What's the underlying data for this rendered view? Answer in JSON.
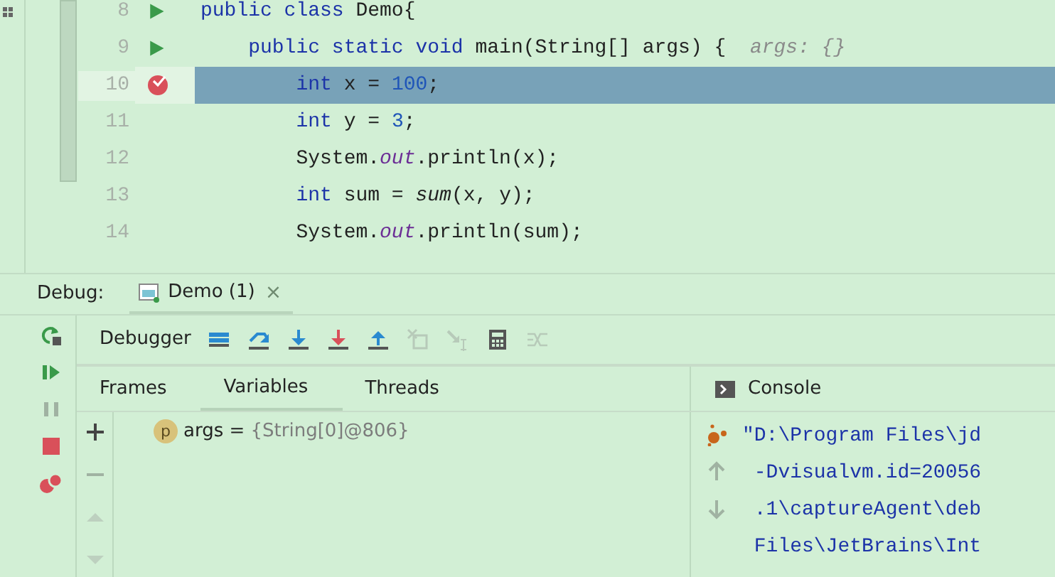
{
  "editor": {
    "lines": [
      {
        "number": "8",
        "run": true,
        "breakpoint": false,
        "current": false,
        "tokens": [
          {
            "t": "public class ",
            "kind": "kw"
          },
          {
            "t": "Demo{",
            "kind": "plain"
          }
        ]
      },
      {
        "number": "9",
        "run": true,
        "breakpoint": false,
        "current": false,
        "tokens": [
          {
            "t": "    public static void ",
            "kind": "kw"
          },
          {
            "t": "main(String[] args) {",
            "kind": "plain"
          },
          {
            "t": "  args: {}",
            "kind": "hint"
          }
        ]
      },
      {
        "number": "10",
        "run": false,
        "breakpoint": true,
        "current": true,
        "tokens": [
          {
            "t": "        int ",
            "kind": "kw"
          },
          {
            "t": "x = ",
            "kind": "plain"
          },
          {
            "t": "100",
            "kind": "num"
          },
          {
            "t": ";",
            "kind": "plain"
          }
        ]
      },
      {
        "number": "11",
        "run": false,
        "breakpoint": false,
        "current": false,
        "tokens": [
          {
            "t": "        int ",
            "kind": "kw"
          },
          {
            "t": "y = ",
            "kind": "plain"
          },
          {
            "t": "3",
            "kind": "num"
          },
          {
            "t": ";",
            "kind": "plain"
          }
        ]
      },
      {
        "number": "12",
        "run": false,
        "breakpoint": false,
        "current": false,
        "tokens": [
          {
            "t": "        System.",
            "kind": "plain"
          },
          {
            "t": "out",
            "kind": "field"
          },
          {
            "t": ".println(x);",
            "kind": "plain"
          }
        ]
      },
      {
        "number": "13",
        "run": false,
        "breakpoint": false,
        "current": false,
        "tokens": [
          {
            "t": "        int ",
            "kind": "kw"
          },
          {
            "t": "sum = ",
            "kind": "plain"
          },
          {
            "t": "sum",
            "kind": "call"
          },
          {
            "t": "(x, y);",
            "kind": "plain"
          }
        ]
      },
      {
        "number": "14",
        "run": false,
        "breakpoint": false,
        "current": false,
        "tokens": [
          {
            "t": "        System.",
            "kind": "plain"
          },
          {
            "t": "out",
            "kind": "field"
          },
          {
            "t": ".println(sum);",
            "kind": "plain"
          }
        ]
      }
    ]
  },
  "debug": {
    "title": "Debug:",
    "session_tab": {
      "label": "Demo (1)",
      "close": "×"
    },
    "side_buttons": [
      {
        "kind": "rerun",
        "disabled": false
      },
      {
        "kind": "resume",
        "disabled": false
      },
      {
        "kind": "pause",
        "disabled": true
      },
      {
        "kind": "stop",
        "disabled": false
      },
      {
        "kind": "breakpoints",
        "disabled": false
      }
    ],
    "toolbar_label": "Debugger",
    "toolbar_buttons": [
      {
        "kind": "frames",
        "disabled": false
      },
      {
        "kind": "step-over",
        "disabled": false
      },
      {
        "kind": "step-into",
        "disabled": false
      },
      {
        "kind": "force-step-into",
        "disabled": false
      },
      {
        "kind": "step-out",
        "disabled": false
      },
      {
        "kind": "drop-frame",
        "disabled": true
      },
      {
        "kind": "run-to-cursor",
        "disabled": true
      },
      {
        "kind": "evaluate",
        "disabled": false
      },
      {
        "kind": "trace",
        "disabled": true
      }
    ],
    "tabs": [
      {
        "label": "Frames",
        "selected": false
      },
      {
        "label": "Variables",
        "selected": true
      },
      {
        "label": "Threads",
        "selected": false
      }
    ],
    "variable_buttons": [
      {
        "kind": "add",
        "disabled": false
      },
      {
        "kind": "remove",
        "disabled": true
      },
      {
        "kind": "up",
        "disabled": true
      },
      {
        "kind": "down",
        "disabled": true
      }
    ],
    "variables": [
      {
        "badge": "p",
        "name": "args",
        "operator": "=",
        "value": "{String[0]@806}"
      }
    ],
    "console": {
      "label": "Console",
      "buttons": [
        {
          "kind": "debug-agent",
          "disabled": false
        },
        {
          "kind": "up",
          "disabled": true
        },
        {
          "kind": "down",
          "disabled": true
        }
      ],
      "lines": [
        "\"D:\\Program Files\\jd",
        " -Dvisualvm.id=20056",
        " .1\\captureAgent\\deb",
        " Files\\JetBrains\\Int"
      ]
    }
  }
}
